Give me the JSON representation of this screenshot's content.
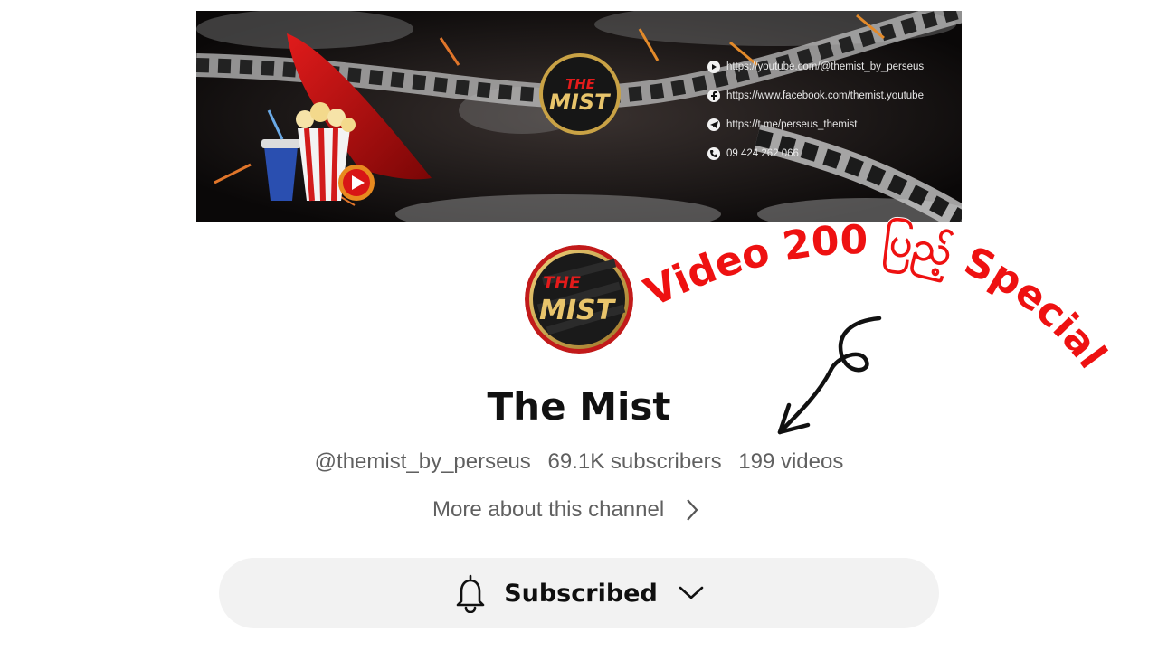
{
  "banner": {
    "logo_text_top": "THE",
    "logo_text_bottom": "MIST",
    "links": [
      {
        "icon": "youtube-icon",
        "text": "https://youtube.com/@themist_by_perseus"
      },
      {
        "icon": "facebook-icon",
        "text": "https://www.facebook.com/themist.youtube"
      },
      {
        "icon": "telegram-icon",
        "text": "https://t.me/perseus_themist"
      },
      {
        "icon": "phone-icon",
        "text": "09 424 262 066"
      }
    ]
  },
  "channel": {
    "avatar_text_top": "THE",
    "avatar_text_bottom": "MIST",
    "name": "The Mist",
    "handle": "@themist_by_perseus",
    "subscribers": "69.1K subscribers",
    "videos": "199 videos",
    "more_label": "More about this channel"
  },
  "subscribe": {
    "label": "Subscribed"
  },
  "overlay": {
    "text": "Video 200 ပြည့် Special",
    "color": "#ee1111"
  }
}
